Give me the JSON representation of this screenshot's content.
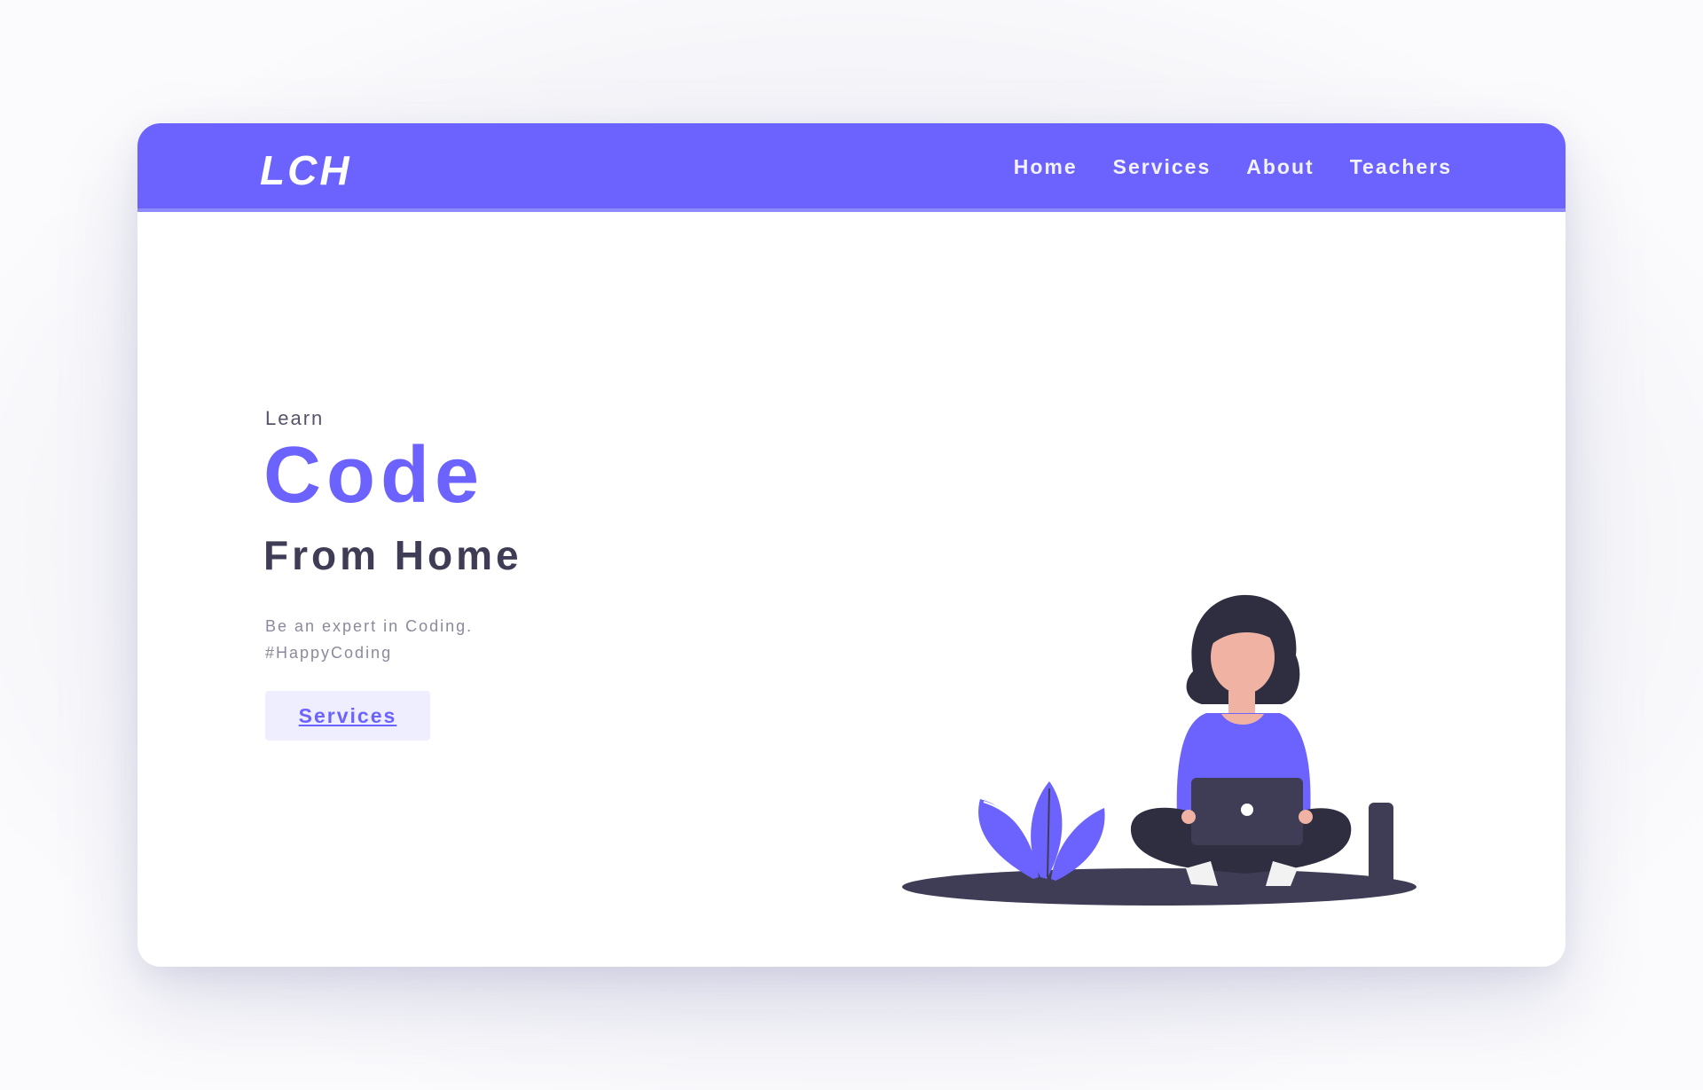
{
  "header": {
    "logo": "LCH",
    "nav": [
      "Home",
      "Services",
      "About",
      "Teachers"
    ]
  },
  "hero": {
    "eyebrow": "Learn",
    "headline": "Code",
    "subhead": "From Home",
    "description_line1": "Be an expert in Coding.",
    "description_line2": "#HappyCoding",
    "cta_label": "Services"
  },
  "colors": {
    "accent": "#6c63ff",
    "dark": "#3f3d56",
    "skin": "#f0b3a3"
  },
  "icons": {
    "illustration": "person-with-laptop-illustration"
  }
}
